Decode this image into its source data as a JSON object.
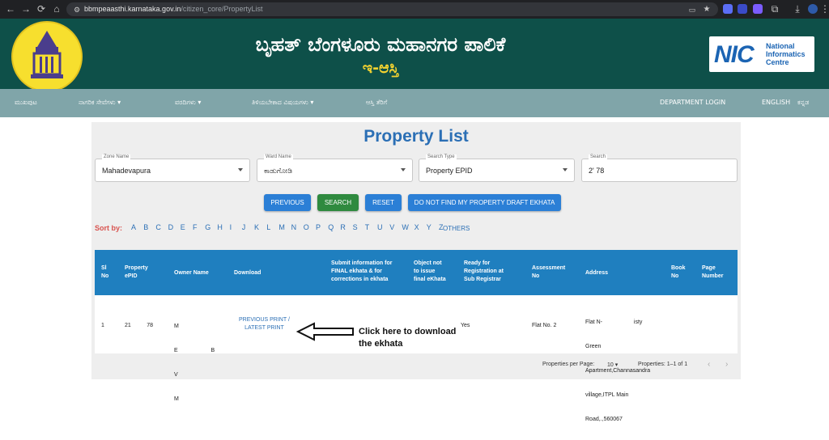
{
  "browser": {
    "url_domain": "bbmpeaasthi.karnataka.gov.in",
    "url_path": "/citizen_core/PropertyList"
  },
  "header": {
    "title_kn": "ಬೃಹತ್ ಬೆಂಗಳೂರು ಮಹಾನಗರ ಪಾಲಿಕೆ",
    "subtitle_kn": "ಇ-ಆಸ್ತಿ",
    "nic_logo": "NIC",
    "nic_line1": "National",
    "nic_line2": "Informatics",
    "nic_line3": "Centre"
  },
  "nav": {
    "home": "ಮುಖಪುಟ",
    "citizen_services": "ನಾಗರಿಕ ಸೇವೆಗಳು",
    "reports": "ವರದಿಗಳು",
    "info": "ತಿಳಿಯಬೇಕಾದ ವಿಷಯಗಳು",
    "property_tax": "ಆಸ್ತಿ ತೆರಿಗೆ",
    "department_login": "DEPARTMENT LOGIN",
    "english": "ENGLISH",
    "kannada": "ಕನ್ನಡ"
  },
  "page": {
    "title": "Property List"
  },
  "filters": {
    "zone": {
      "label": "Zone Name",
      "value": "Mahadevapura"
    },
    "ward": {
      "label": "Ward Name",
      "value": "ಕಾಡುಗೋಡಿ"
    },
    "search_type": {
      "label": "Search Type",
      "value": "Property EPID"
    },
    "search": {
      "label": "Search",
      "value": "2'            78"
    }
  },
  "buttons": {
    "previous": "PREVIOUS",
    "search": "SEARCH",
    "reset": "RESET",
    "not_find": "DO NOT FIND MY PROPERTY DRAFT EKHATA"
  },
  "sort": {
    "label": "Sort by:",
    "letters": [
      "A",
      "B",
      "C",
      "D",
      "E",
      "F",
      "G",
      "H",
      "I",
      "J",
      "K",
      "L",
      "M",
      "N",
      "O",
      "P",
      "Q",
      "R",
      "S",
      "T",
      "U",
      "V",
      "W",
      "X",
      "Y",
      "Z"
    ],
    "others": "OTHERS"
  },
  "table": {
    "headers": {
      "sl_no_1": "Sl",
      "sl_no_2": "No",
      "epid_1": "Property",
      "epid_2": "ePID",
      "owner": "Owner Name",
      "download": "Download",
      "submit_1": "Submit information for",
      "submit_2": "FINAL ekhata & for",
      "submit_3": "corrections in ekhata",
      "object_1": "Object not",
      "object_2": "to issue",
      "object_3": "final eKhata",
      "ready_1": "Ready for",
      "ready_2": "Registration at",
      "ready_3": "Sub Registrar",
      "assessment_1": "Assessment",
      "assessment_2": "No",
      "address": "Address",
      "book_1": "Book",
      "book_2": "No",
      "page_1": "Page",
      "page_2": "Number"
    },
    "row": {
      "sl_no": "1",
      "epid": "21          78",
      "owner_1": "M",
      "owner_2": "E                     B",
      "owner_3": "V",
      "owner_4": "M",
      "download_1": "PREVIOUS PRINT /",
      "download_2": "LATEST PRINT",
      "ready": "Yes",
      "assessment": "Flat No. 2",
      "address_1": "Flat N-                    isty",
      "address_2": "Green",
      "address_3": "Apartment,Channasandra",
      "address_4": "village,ITPL Main",
      "address_5": "Road,.,560067"
    }
  },
  "annotation": {
    "line1": "Click here to download",
    "line2": "the ekhata"
  },
  "pagination": {
    "per_page_label": "Properties per Page:",
    "per_page_value": "10",
    "range": "Properties: 1–1 of 1"
  }
}
